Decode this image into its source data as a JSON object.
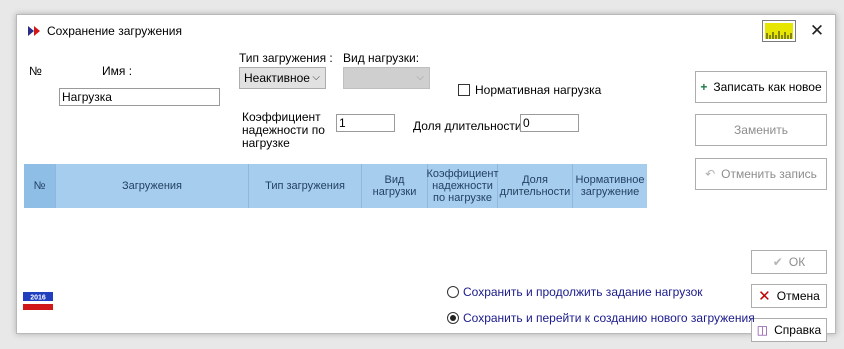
{
  "window": {
    "title": "Сохранение загружения"
  },
  "form": {
    "num_label": "№",
    "name_label": "Имя :",
    "name_value": "Нагрузка",
    "load_type_label": "Тип загружения :",
    "load_type_value": "Неактивное",
    "kind_label": "Вид нагрузки:",
    "kind_value": "",
    "normative_label": "Нормативная нагрузка",
    "normative_checked": false,
    "coef_label_l1": "Коэффициент",
    "coef_label_l2": "надежности по",
    "coef_label_l3": "нагрузке",
    "coef_value": "1",
    "duration_label": "Доля длительности",
    "duration_value": "0"
  },
  "grid": {
    "columns": [
      "№",
      "Загружения",
      "Тип загружения",
      [
        "Вид",
        "нагрузки"
      ],
      [
        "Коэффициент",
        "надежности",
        "по нагрузке"
      ],
      [
        "Доля",
        "длительности"
      ],
      [
        "Нормативное",
        "загружение"
      ]
    ]
  },
  "buttons": {
    "save_new": "Записать как новое",
    "replace": "Заменить",
    "cancel_record": "Отменить запись",
    "ok": "ОК",
    "cancel": "Отмена",
    "help": "Справка"
  },
  "radios": {
    "continue_label": "Сохранить и продолжить задание нагрузок",
    "new_label": "Сохранить и перейти к созданию нового загружения",
    "selected": "new"
  },
  "badge": {
    "year": "2016"
  },
  "colors": {
    "grid_header": "#a7cdee",
    "grid_header_num": "#8ebde6",
    "radio_text": "#1a1a8c",
    "save_plus": "#1a7a4a",
    "cancel_x": "#c00000"
  }
}
